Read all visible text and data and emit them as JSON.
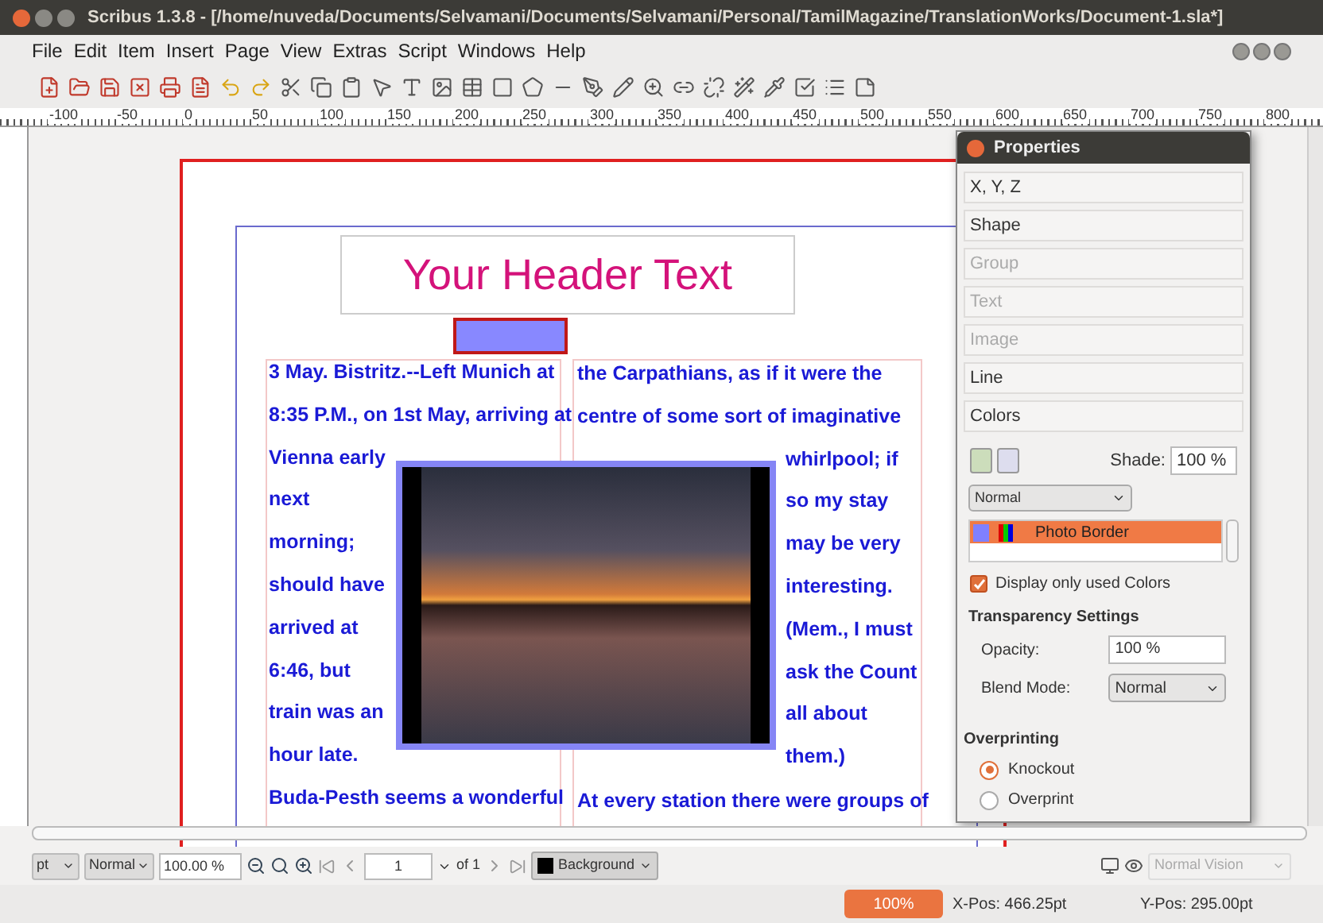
{
  "window": {
    "title": "Scribus 1.3.8 - [/home/nuveda/Documents/Selvamani/Documents/Selvamani/Personal/TamilMagazine/TranslationWorks/Document-1.sla*]"
  },
  "menu": [
    {
      "label": "File"
    },
    {
      "label": "Edit"
    },
    {
      "label": "Item"
    },
    {
      "label": "Insert"
    },
    {
      "label": "Page"
    },
    {
      "label": "View"
    },
    {
      "label": "Extras"
    },
    {
      "label": "Script"
    },
    {
      "label": "Windows"
    },
    {
      "label": "Help"
    }
  ],
  "ruler": {
    "ticks": [
      "-100",
      "-50",
      "0",
      "50",
      "100",
      "150",
      "200",
      "250",
      "300",
      "350",
      "400",
      "450",
      "500",
      "550",
      "600",
      "650",
      "700",
      "750",
      "800"
    ]
  },
  "document": {
    "header_text": "Your Header Text",
    "left_column": [
      "3 May. Bistritz.--Left Munich at",
      "8:35 P.M., on 1st May, arriving at",
      "Vienna early",
      "next",
      "morning;",
      "should have",
      "arrived at",
      "6:46, but",
      "train was an",
      "hour late.",
      "Buda-Pesth seems a wonderful"
    ],
    "right_column": [
      {
        "text": "the Carpathians, as if it were the",
        "kind": "full"
      },
      {
        "text": "centre of some sort of imaginative",
        "kind": "full"
      },
      {
        "text": "whirlpool; if",
        "kind": "wrap"
      },
      {
        "text": "so my stay",
        "kind": "wrap"
      },
      {
        "text": "may be very",
        "kind": "wrap"
      },
      {
        "text": "interesting.",
        "kind": "wrap"
      },
      {
        "text": "(Mem., I must",
        "kind": "wrap"
      },
      {
        "text": "ask the Count",
        "kind": "wrap"
      },
      {
        "text": "all about",
        "kind": "wrap"
      },
      {
        "text": "them.)",
        "kind": "wrap"
      },
      {
        "text": "At every station there were groups of",
        "kind": "full"
      }
    ]
  },
  "properties": {
    "title": "Properties",
    "sections": [
      {
        "label": "X, Y, Z",
        "disabled": false
      },
      {
        "label": "Shape",
        "disabled": false
      },
      {
        "label": "Group",
        "disabled": true
      },
      {
        "label": "Text",
        "disabled": true
      },
      {
        "label": "Image",
        "disabled": true
      },
      {
        "label": "Line",
        "disabled": false
      },
      {
        "label": "Colors",
        "disabled": false
      }
    ],
    "shade_label": "Shade:",
    "shade_value": "100 %",
    "mode": "Normal",
    "colors": [
      {
        "name": "Photo Border",
        "selected": true,
        "color": "#8080ff"
      }
    ],
    "display_only_used": {
      "label": "Display only used Colors",
      "checked": true
    },
    "transparency": {
      "heading": "Transparency Settings",
      "opacity_label": "Opacity:",
      "opacity_value": "100 %",
      "blend_label": "Blend Mode:",
      "blend_value": "Normal"
    },
    "overprinting": {
      "heading": "Overprinting",
      "options": [
        {
          "label": "Knockout",
          "selected": true
        },
        {
          "label": "Overprint",
          "selected": false
        }
      ]
    }
  },
  "bottom_toolbar": {
    "unit": "pt",
    "mode": "Normal",
    "zoom": "100.00 %",
    "page": "1",
    "of_pages": "of 1",
    "layer": "Background",
    "vision": "Normal Vision"
  },
  "status_bar": {
    "zoom": "100%",
    "x_pos": "X-Pos: 466.25pt",
    "y_pos": "Y-Pos: 295.00pt"
  }
}
